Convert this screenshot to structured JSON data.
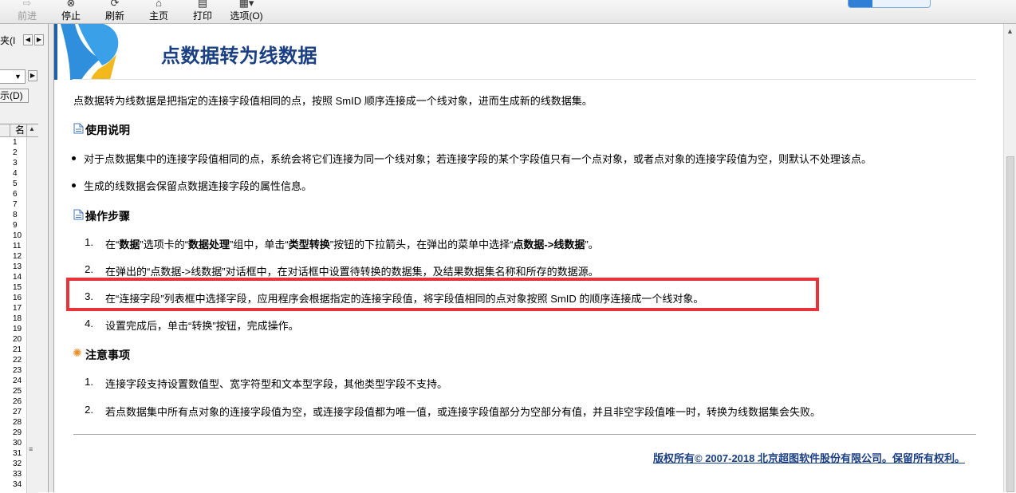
{
  "toolbar": {
    "forward": "前进",
    "stop": "停止",
    "refresh": "刷新",
    "home": "主页",
    "print": "打印",
    "options": "选项(O)"
  },
  "left_pane": {
    "tab_label": "夹(I",
    "show_button": "显示(D)",
    "column_header": "名",
    "rows": [
      "1",
      "2",
      "3",
      "4",
      "5",
      "6",
      "7",
      "8",
      "9",
      "10",
      "11",
      "12",
      "13",
      "14",
      "15",
      "16",
      "17",
      "18",
      "19",
      "20",
      "21",
      "22",
      "23",
      "24",
      "25",
      "26",
      "27",
      "28",
      "29",
      "30",
      "31",
      "32",
      "33",
      "34"
    ]
  },
  "page": {
    "title": "点数据转为线数据",
    "intro": "点数据转为线数据是把指定的连接字段值相同的点，按照 SmID 顺序连接成一个线对象，进而生成新的线数据集。",
    "usage": {
      "heading": "使用说明",
      "items": [
        "对于点数据集中的连接字段值相同的点，系统会将它们连接为同一个线对象；若连接字段的某个字段值只有一个点对象，或者点对象的连接字段值为空，则默认不处理该点。",
        "生成的线数据会保留点数据连接字段的属性信息。"
      ]
    },
    "steps": {
      "heading": "操作步骤",
      "step1": {
        "num": "1.",
        "a": "在“",
        "b": "数据",
        "c": "”选项卡的“",
        "d": "数据处理",
        "e": "”组中，单击“",
        "f": "类型转换",
        "g": "”按钮的下拉箭头，在弹出的菜单中选择“",
        "h": "点数据->线数据",
        "i": "”。"
      },
      "step2": {
        "num": "2.",
        "text": "在弹出的“点数据->线数据”对话框中，在对话框中设置待转换的数据集，及结果数据集名称和所存的数据源。"
      },
      "step3": {
        "num": "3.",
        "text": "在“连接字段”列表框中选择字段，应用程序会根据指定的连接字段值，将字段值相同的点对象按照 SmID 的顺序连接成一个线对象。"
      },
      "step4": {
        "num": "4.",
        "text": "设置完成后，单击“转换”按钮，完成操作。"
      }
    },
    "notes": {
      "heading": "注意事项",
      "items": [
        {
          "num": "1.",
          "text": "连接字段支持设置数值型、宽字符型和文本型字段，其他类型字段不支持。"
        },
        {
          "num": "2.",
          "text": "若点数据集中所有点对象的连接字段值为空，或连接字段值都为唯一值，或连接字段值部分为空部分有值，并且非空字段值唯一时，转换为线数据集会失败。"
        }
      ]
    },
    "copyright": "版权所有© 2007-2018 北京超图软件股份有限公司。保留所有权利。"
  },
  "colors": {
    "title": "#1a3f82",
    "highlight_box": "#e8333a",
    "logo_blue": "#2f8fdc",
    "logo_yellow": "#f3b81c"
  }
}
